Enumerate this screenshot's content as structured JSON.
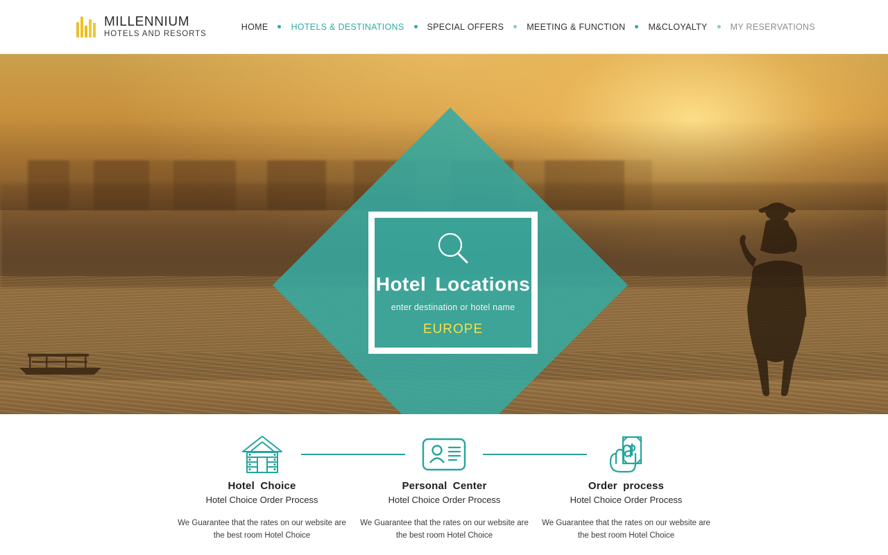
{
  "brand": {
    "name": "MILLENNIUM",
    "tagline": "HOTELS  AND  RESORTS",
    "logo_icon": "bar-chart-logo-icon",
    "logo_color": "#e9bb20"
  },
  "nav": {
    "items": [
      {
        "label": "HOME",
        "state": "default"
      },
      {
        "label": "HOTELS & DESTINATIONS",
        "state": "active"
      },
      {
        "label": "SPECIAL OFFERS",
        "state": "default"
      },
      {
        "label": "MEETING & FUNCTION",
        "state": "default"
      },
      {
        "label": "M&CLOYALTY",
        "state": "default"
      },
      {
        "label": "MY RESERVATIONS",
        "state": "muted"
      }
    ],
    "separator_color": "#2fada4",
    "active_color": "#2fada4"
  },
  "hero": {
    "search_icon": "magnifier-icon",
    "title": "Hotel  Locations",
    "subtitle": "enter destination or hotel name",
    "region": "EUROPE",
    "region_color": "#f4e04a",
    "diamond_color": "#36aaa1",
    "scene": "sunset beach with horse rider and boat"
  },
  "features": {
    "accent_color": "#2aa39b",
    "items": [
      {
        "icon": "cabin-house-icon",
        "title": "Hotel  Choice",
        "subtitle": "Hotel Choice Order Process",
        "description": "We Guarantee that the rates on our website are the best room Hotel Choice"
      },
      {
        "icon": "id-card-person-icon",
        "title": "Personal  Center",
        "subtitle": "Hotel Choice Order Process",
        "description": "We Guarantee that the rates on our website are the best room Hotel Choice"
      },
      {
        "icon": "hand-holding-note-icon",
        "title": "Order  process",
        "subtitle": "Hotel Choice Order Process",
        "description": "We Guarantee that the rates on our website are the best room Hotel Choice"
      }
    ]
  }
}
